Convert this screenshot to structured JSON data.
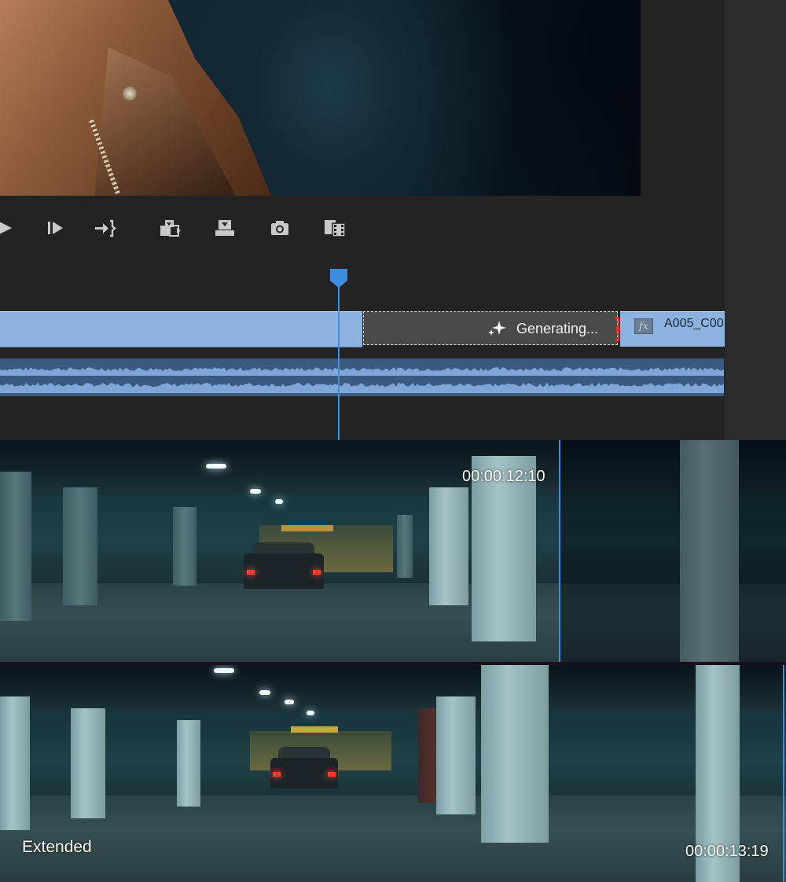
{
  "program_monitor": {
    "description_icons": [
      "play-icon",
      "step-forward-icon",
      "go-to-out-icon",
      "insert-icon",
      "overwrite-icon",
      "export-frame-icon",
      "comparison-view-icon"
    ]
  },
  "timeline": {
    "generating_label": "Generating...",
    "next_clip": {
      "fx_label": "fx",
      "name": "A005_C00"
    },
    "colors": {
      "clip": "#8cb3e0",
      "playhead": "#3d8ee0",
      "generating_bg": "#494949",
      "trim_marker": "#e0302a"
    }
  },
  "comparison": {
    "original_timecode": "00:00:12:10",
    "extended_timecode": "00:00:13:19",
    "extended_label": "Extended"
  }
}
